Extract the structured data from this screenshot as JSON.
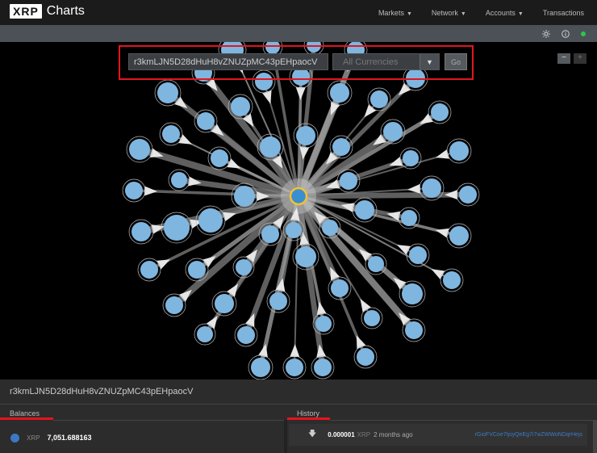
{
  "brand": {
    "logo_mark": "XRP",
    "app_name": "Charts"
  },
  "nav": [
    {
      "label": "Markets",
      "dropdown": true
    },
    {
      "label": "Network",
      "dropdown": true
    },
    {
      "label": "Accounts",
      "dropdown": true
    },
    {
      "label": "Transactions",
      "dropdown": false
    }
  ],
  "search": {
    "account_value": "r3kmLJN5D28dHuH8vZNUZpMC43pEHpaocV",
    "currency_placeholder": "All Currencies",
    "go_label": "Go"
  },
  "zoom": {
    "minus": "−",
    "plus": "+"
  },
  "account_title": "r3kmLJN5D28dHuH8vZNUZpMC43pEHpaocV",
  "balances": {
    "title": "Balances",
    "rows": [
      {
        "currency": "XRP",
        "value": "7,051.688163"
      }
    ]
  },
  "history": {
    "title": "History",
    "rows": [
      {
        "amount": "0.000001",
        "currency": "XRP",
        "time": "2 months ago",
        "address": "rGioFVCoe7tjsyQeEg7i7wZWWoNDqrHejs"
      }
    ]
  },
  "colors": {
    "node": "#7fb6e0",
    "center_ring": "#f2c230",
    "highlight": "#e3151e",
    "status": "#2ec44b"
  }
}
